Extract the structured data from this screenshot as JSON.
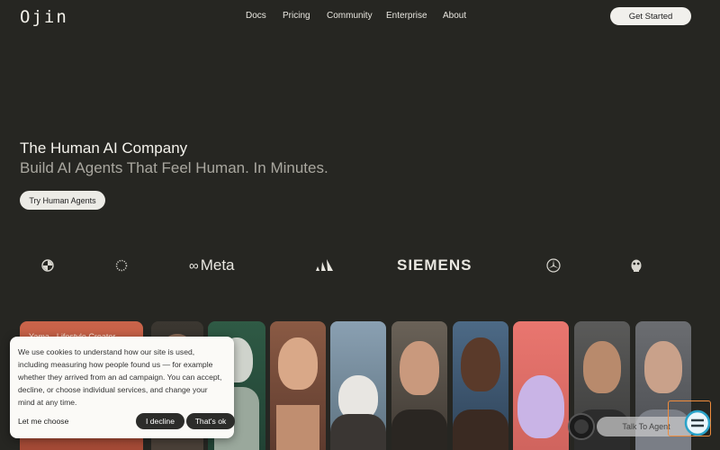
{
  "header": {
    "logo_text": "Ojin",
    "nav": [
      "Docs",
      "Pricing",
      "Community",
      "Enterprise",
      "About"
    ],
    "cta_label": "Get Started"
  },
  "hero": {
    "title": "The Human AI Company",
    "subtitle": "Build AI Agents That Feel Human. In Minutes.",
    "button_label": "Try Human Agents"
  },
  "logos": {
    "meta": "Meta",
    "siemens": "SIEMENS",
    "icons": [
      "bmw-icon",
      "dotted-circle-icon",
      "adidas-icon",
      "mercedes-icon",
      "wwf-icon"
    ]
  },
  "cards": {
    "first_tag": "Yama · Lifestyle Creator"
  },
  "cookie": {
    "text": "We use cookies to understand how our site is used, including measuring how people found us — for example whether they arrived from an ad campaign. You can accept, decline, or choose individual services, and change your mind at any time.",
    "choose_label": "Let me choose",
    "decline_label": "I decline",
    "ok_label": "That's ok"
  },
  "widget": {
    "talk_label": "Talk To Agent"
  },
  "colors": {
    "background": "#262622",
    "button_light": "#f1f0ec",
    "accent_orange": "#f08c3c",
    "accent_teal": "#2aa3c9"
  }
}
